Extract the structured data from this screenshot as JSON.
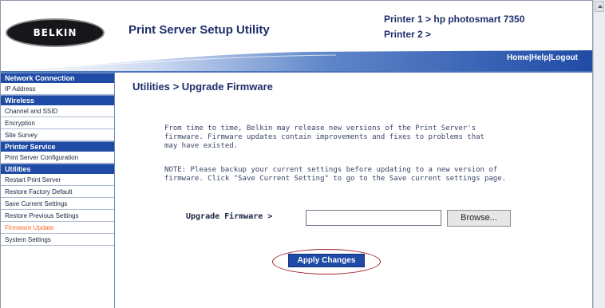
{
  "header": {
    "logo_text": "BELKIN",
    "app_title": "Print Server Setup Utility",
    "printer1": "Printer 1 > hp photosmart 7350",
    "printer2": "Printer 2 >"
  },
  "toplinks": {
    "home": "Home",
    "sep1": "|",
    "help": "Help",
    "sep2": "|",
    "logout": "Logout"
  },
  "sidebar": {
    "sections": [
      {
        "title": "Network Connection",
        "items": [
          "IP Address"
        ]
      },
      {
        "title": "Wireless",
        "items": [
          "Channel and SSID",
          "Encryption",
          "Site Survey"
        ]
      },
      {
        "title": "Printer Service",
        "items": [
          "Print Server Configuration"
        ]
      },
      {
        "title": "Utilities",
        "items": [
          "Restart Print Server",
          "Restore Factory Default",
          "Save Current Settings",
          "Restore Previous Settings",
          "Firmware Update",
          "System Settings"
        ]
      }
    ],
    "active_item": "Firmware Update"
  },
  "main": {
    "heading": "Utilities > Upgrade Firmware",
    "para1": "From time to time, Belkin may release new versions of the Print Server's firmware. Firmware updates contain improvements and fixes to problems that may have existed.",
    "para2": "NOTE: Please backup your current settings before updating to a new version of firmware. Click \"Save Current Setting\" to go to the Save current settings page.",
    "upload_label": "Upgrade Firmware >",
    "file_value": "",
    "browse_label": "Browse...",
    "apply_label": "Apply Changes"
  },
  "colors": {
    "nav_blue": "#1f4ba6",
    "title_blue": "#1f2e6b",
    "active_orange": "#ff6a2e",
    "highlight_red": "#a0202a"
  }
}
